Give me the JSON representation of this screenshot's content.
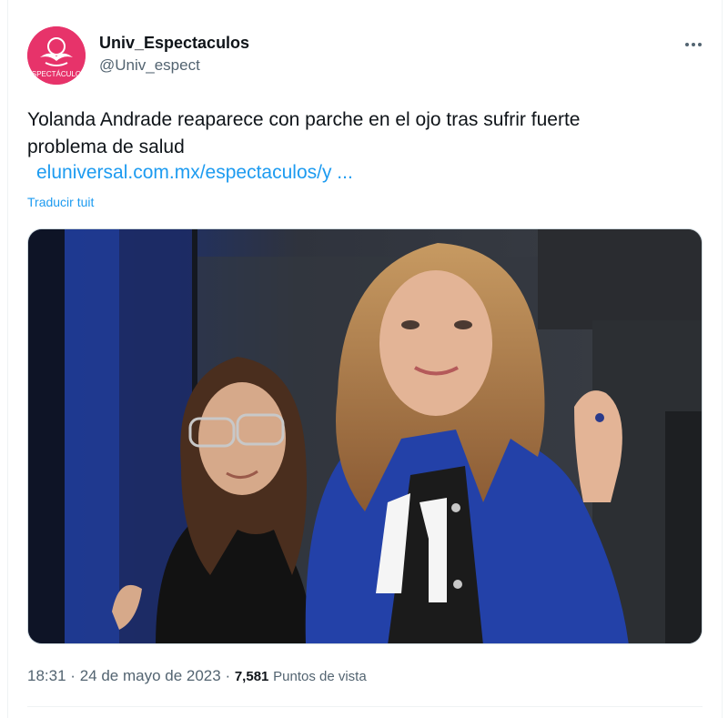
{
  "author": {
    "display_name": "Univ_Espectaculos",
    "handle": "@Univ_espect",
    "avatar_text": "ESPECTÁCULOS",
    "avatar_color": "#e7336a"
  },
  "tweet": {
    "text": "Yolanda Andrade reaparece con parche en el ojo tras sufrir fuerte problema de salud",
    "link_text": "eluniversal.com.mx/espectaculos/y ...",
    "translate_label": "Traducir tuit"
  },
  "meta": {
    "time": "18:31",
    "separator": "·",
    "date": "24 de mayo de 2023",
    "views_count": "7,581",
    "views_label": "Puntos de vista"
  },
  "colors": {
    "link": "#1d9bf0",
    "secondary_text": "#536471",
    "primary_text": "#0f1419"
  },
  "icons": {
    "more": "more-dots-icon"
  }
}
